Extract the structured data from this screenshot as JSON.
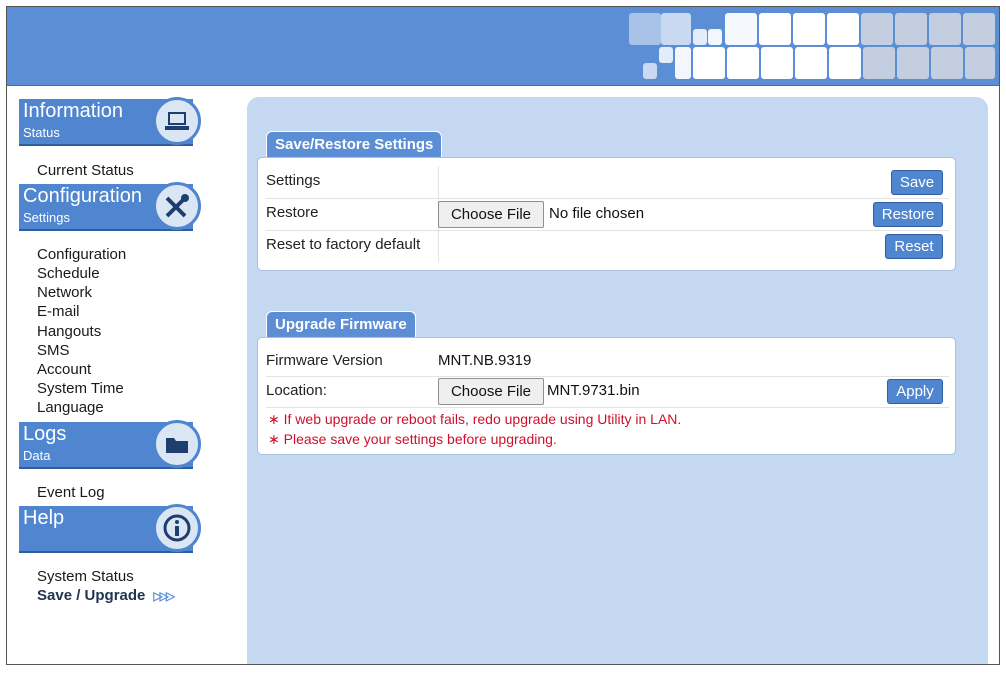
{
  "sidebar": {
    "sections": [
      {
        "title": "Information",
        "subtitle": "Status",
        "icon": "laptop-icon"
      },
      {
        "title": "Configuration",
        "subtitle": "Settings",
        "icon": "tools-icon"
      },
      {
        "title": "Logs",
        "subtitle": "Data",
        "icon": "folder-icon"
      },
      {
        "title": "Help",
        "subtitle": "",
        "icon": "info-icon"
      }
    ],
    "information_links": [
      "Current Status"
    ],
    "configuration_links": [
      "Configuration",
      "Schedule",
      "Network",
      "E-mail",
      "Hangouts",
      "SMS",
      "Account",
      "System Time",
      "Language"
    ],
    "logs_links": [
      "Event Log"
    ],
    "help_links": [
      "System Status",
      "Save / Upgrade"
    ],
    "active_link": "Save / Upgrade"
  },
  "save_restore": {
    "tab_label": "Save/Restore Settings",
    "rows": [
      {
        "label": "Settings",
        "button": "Save"
      },
      {
        "label": "Restore",
        "file_button": "Choose File",
        "file_name": "No file chosen",
        "button": "Restore"
      },
      {
        "label": "Reset to factory default",
        "button": "Reset"
      }
    ]
  },
  "firmware": {
    "tab_label": "Upgrade Firmware",
    "version_label": "Firmware Version",
    "version_value": "MNT.NB.9319",
    "location_label": "Location:",
    "file_button": "Choose File",
    "file_name": "MNT.9731.bin",
    "apply_button": "Apply",
    "warnings": [
      "If web upgrade or reboot fails, redo upgrade using Utility in LAN.",
      "Please save your settings before upgrading."
    ],
    "warning_mark": "∗"
  },
  "colors": {
    "header_blue": "#5b8ed4",
    "content_bg": "#c5d8f1",
    "warning_red": "#d0102a"
  }
}
